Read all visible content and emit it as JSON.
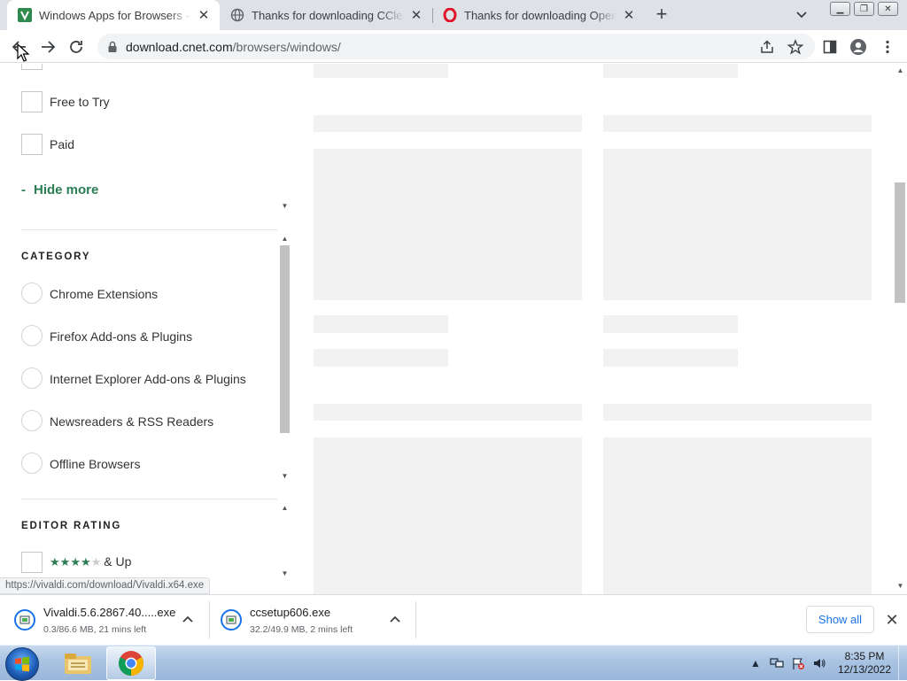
{
  "browser": {
    "tabs": [
      {
        "title": "Windows Apps for Browsers - CNET Download",
        "favicon": "cnet-green-icon",
        "active": true
      },
      {
        "title": "Thanks for downloading CCleaner",
        "favicon": "globe-icon",
        "active": false
      },
      {
        "title": "Thanks for downloading Opera",
        "favicon": "opera-icon",
        "active": false
      }
    ],
    "url_host": "download.cnet.com",
    "url_path": "/browsers/windows/"
  },
  "filters": {
    "license_options": [
      {
        "label": "Free to Try"
      },
      {
        "label": "Paid"
      }
    ],
    "hide_more": "Hide more",
    "hide_more_prefix": "-",
    "category_title": "CATEGORY",
    "categories": [
      {
        "label": "Chrome Extensions"
      },
      {
        "label": "Firefox Add-ons & Plugins"
      },
      {
        "label": "Internet Explorer Add-ons & Plugins"
      },
      {
        "label": "Newsreaders & RSS Readers"
      },
      {
        "label": "Offline Browsers"
      }
    ],
    "editor_rating_title": "EDITOR RATING",
    "rating_option": {
      "stars": 4,
      "of": 5,
      "suffix": "& Up"
    }
  },
  "status_url": "https://vivaldi.com/download/Vivaldi.x64.exe",
  "downloads": [
    {
      "name": "Vivaldi.5.6.2867.40.....exe",
      "status": "0.3/86.6 MB, 21 mins left"
    },
    {
      "name": "ccsetup606.exe",
      "status": "32.2/49.9 MB, 2 mins left"
    }
  ],
  "show_all": "Show all",
  "taskbar": {
    "time": "8:35 PM",
    "date": "12/13/2022",
    "apps": [
      "windows-explorer-icon",
      "chrome-icon"
    ]
  },
  "colors": {
    "accent_green": "#2b7d53",
    "skeleton": "#f2f2f2",
    "link_blue": "#1a73e8"
  }
}
